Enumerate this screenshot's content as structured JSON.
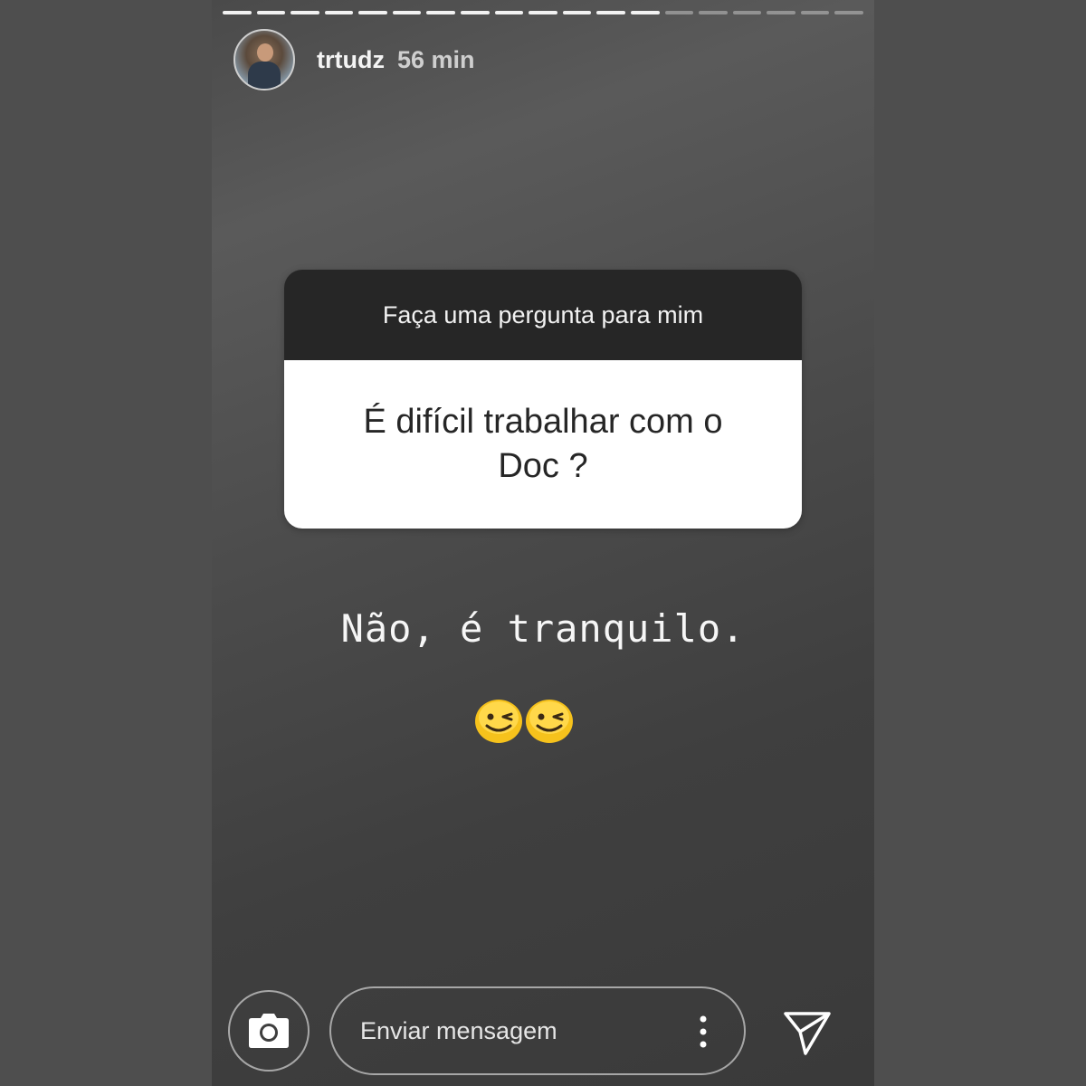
{
  "story": {
    "progress_total_segments": 19,
    "progress_completed_segments": 13,
    "username": "trtudz",
    "time_ago": "56 min",
    "avatar_icon": "profile-photo",
    "question_sticker": {
      "prompt": "Faça uma pergunta para mim",
      "question": "É difícil trabalhar com o Doc ?"
    },
    "answer_text": "Não, é tranquilo.",
    "emojis": [
      "winking-face-emoji",
      "winking-face-emoji"
    ],
    "bottom_bar": {
      "camera_icon": "camera-icon",
      "message_placeholder": "Enviar mensagem",
      "more_icon": "more-vertical-icon",
      "send_icon": "send-icon"
    }
  },
  "colors": {
    "background": "#4e4e4e",
    "sticker_header": "#262626",
    "sticker_body": "#ffffff",
    "emoji_yellow": "#f6c21c"
  }
}
